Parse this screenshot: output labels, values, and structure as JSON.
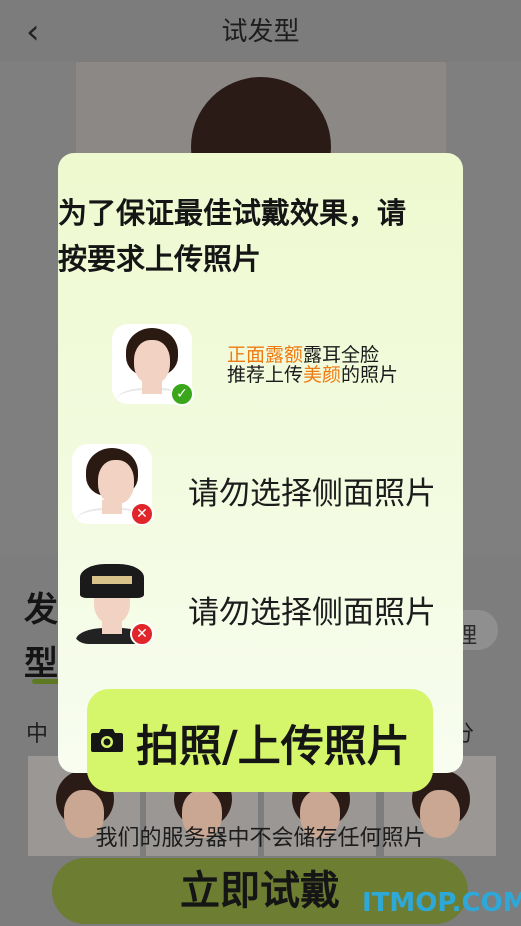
{
  "header": {
    "back_glyph": "‹",
    "title": "试发型"
  },
  "background": {
    "side_label_1": "发",
    "side_label_2": "型",
    "pill_text": "理",
    "mid_left": "中",
    "mid_right": "分",
    "note": "我们的服务器中不会储存任何照片",
    "try_button": "立即试戴",
    "watermark": "ITMOP.COM"
  },
  "modal": {
    "heading_line1": "为了保证最佳试戴效果，请",
    "heading_line2": "按要求上传照片",
    "rules": [
      {
        "status": "ok",
        "line1_highlight": "正面露额",
        "line1_rest": "露耳全脸",
        "line2_prefix": "推荐上传",
        "line2_highlight": "美颜",
        "line2_suffix": "的照片"
      },
      {
        "status": "bad",
        "text": "请勿选择侧面照片"
      },
      {
        "status": "bad",
        "text": "请勿选择侧面照片"
      }
    ],
    "badges": {
      "ok": "✓",
      "bad": "✕"
    },
    "upload_button": "拍照/上传照片",
    "icons": [
      "camera-icon",
      "check-badge-icon",
      "close-badge-icon",
      "back-arrow-icon"
    ],
    "colors": {
      "highlight": "#f07a12",
      "upload_bg": "#d5f56b",
      "ok": "#3aa619",
      "bad": "#e0262b"
    }
  }
}
